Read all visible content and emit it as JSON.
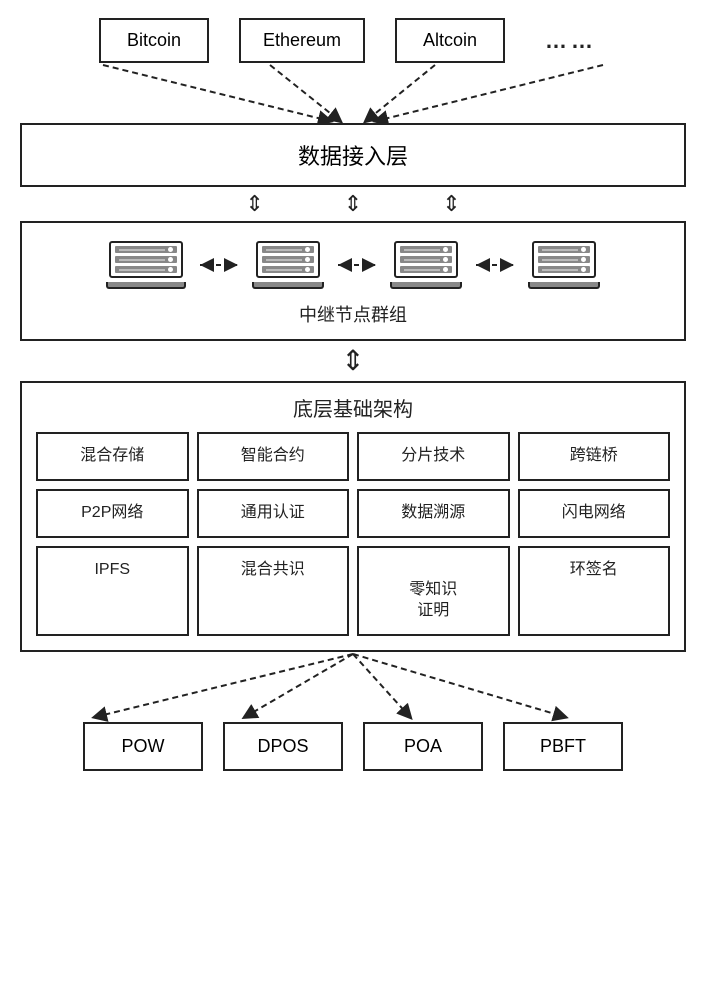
{
  "topNodes": [
    {
      "id": "bitcoin",
      "label": "Bitcoin"
    },
    {
      "id": "ethereum",
      "label": "Ethereum"
    },
    {
      "id": "altcoin",
      "label": "Altcoin"
    },
    {
      "id": "ellipsis",
      "label": "……"
    }
  ],
  "dataLayer": {
    "label": "数据接入层"
  },
  "relayGroup": {
    "label": "中继节点群组",
    "servers": 4
  },
  "infraLayer": {
    "title": "底层基础架构",
    "cells": [
      {
        "id": "mixed-storage",
        "label": "混合存储"
      },
      {
        "id": "smart-contract",
        "label": "智能合约"
      },
      {
        "id": "sharding",
        "label": "分片技术"
      },
      {
        "id": "cross-chain",
        "label": "跨链桥"
      },
      {
        "id": "p2p-network",
        "label": "P2P网络"
      },
      {
        "id": "universal-auth",
        "label": "通用认证"
      },
      {
        "id": "data-tracing",
        "label": "数据溯源"
      },
      {
        "id": "lightning",
        "label": "闪电网络"
      },
      {
        "id": "ipfs",
        "label": "IPFS"
      },
      {
        "id": "hybrid-consensus",
        "label": "混合共识"
      },
      {
        "id": "zkp",
        "label": "零知识\n证明"
      },
      {
        "id": "ring-sig",
        "label": "环签名"
      }
    ]
  },
  "consensusNodes": [
    {
      "id": "pow",
      "label": "POW"
    },
    {
      "id": "dpos",
      "label": "DPOS"
    },
    {
      "id": "poa",
      "label": "POA"
    },
    {
      "id": "pbft",
      "label": "PBFT"
    }
  ]
}
